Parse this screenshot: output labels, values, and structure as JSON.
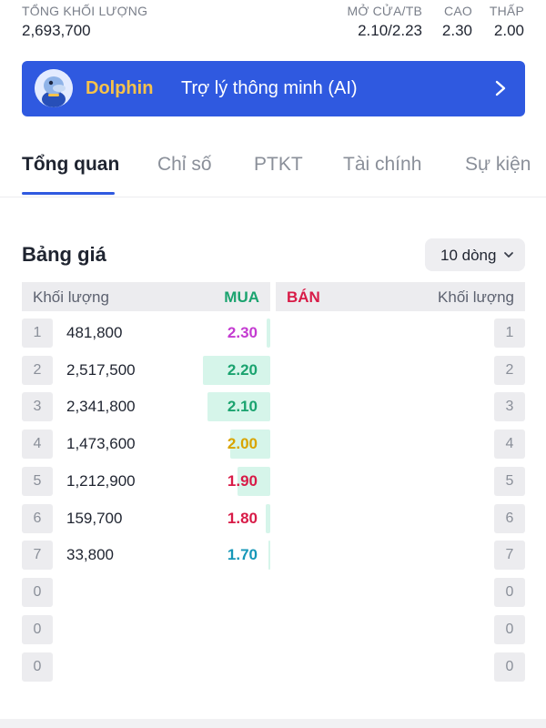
{
  "stats": {
    "total_volume_label": "TỔNG KHỐI LƯỢNG",
    "total_volume_value": "2,693,700",
    "open_avg_label": "MỞ CỬA/TB",
    "open_avg_value": "2.10/2.23",
    "high_label": "CAO",
    "high_value": "2.30",
    "low_label": "THẤP",
    "low_value": "2.00"
  },
  "banner": {
    "brand": "Dolphin",
    "text": "Trợ lý thông minh (AI)",
    "color": "#2f59e0"
  },
  "tabs": [
    {
      "label": "Tổng quan",
      "active": true
    },
    {
      "label": "Chỉ số",
      "active": false
    },
    {
      "label": "PTKT",
      "active": false
    },
    {
      "label": "Tài chính",
      "active": false
    },
    {
      "label": "Sự kiện",
      "active": false
    }
  ],
  "order_book": {
    "title": "Bảng giá",
    "rows_option": "10 dòng",
    "header": {
      "bid_volume": "Khối lượng",
      "bid": "MUA",
      "ask": "BÁN",
      "ask_volume": "Khối lượng"
    },
    "colors": {
      "bid_header": "#1aa36f",
      "ask_header": "#d81b47",
      "bid_bar": "#d6f5ea"
    },
    "bids": [
      {
        "index": "1",
        "volume": "481,800",
        "price": "2.30",
        "price_color": "#c43bd1",
        "depth": 0.05
      },
      {
        "index": "2",
        "volume": "2,517,500",
        "price": "2.20",
        "price_color": "#1aa36f",
        "depth": 0.98
      },
      {
        "index": "3",
        "volume": "2,341,800",
        "price": "2.10",
        "price_color": "#1aa36f",
        "depth": 0.92
      },
      {
        "index": "4",
        "volume": "1,473,600",
        "price": "2.00",
        "price_color": "#d9a400",
        "depth": 0.58
      },
      {
        "index": "5",
        "volume": "1,212,900",
        "price": "1.90",
        "price_color": "#d81b47",
        "depth": 0.48
      },
      {
        "index": "6",
        "volume": "159,700",
        "price": "1.80",
        "price_color": "#d81b47",
        "depth": 0.06
      },
      {
        "index": "7",
        "volume": "33,800",
        "price": "1.70",
        "price_color": "#1697b8",
        "depth": 0.01
      },
      {
        "index": "0",
        "volume": "",
        "price": "",
        "price_color": "#1f2430",
        "depth": 0
      },
      {
        "index": "0",
        "volume": "",
        "price": "",
        "price_color": "#1f2430",
        "depth": 0
      },
      {
        "index": "0",
        "volume": "",
        "price": "",
        "price_color": "#1f2430",
        "depth": 0
      }
    ],
    "asks": [
      {
        "index": "1"
      },
      {
        "index": "2"
      },
      {
        "index": "3"
      },
      {
        "index": "4"
      },
      {
        "index": "5"
      },
      {
        "index": "6"
      },
      {
        "index": "7"
      },
      {
        "index": "0"
      },
      {
        "index": "0"
      },
      {
        "index": "0"
      }
    ]
  }
}
